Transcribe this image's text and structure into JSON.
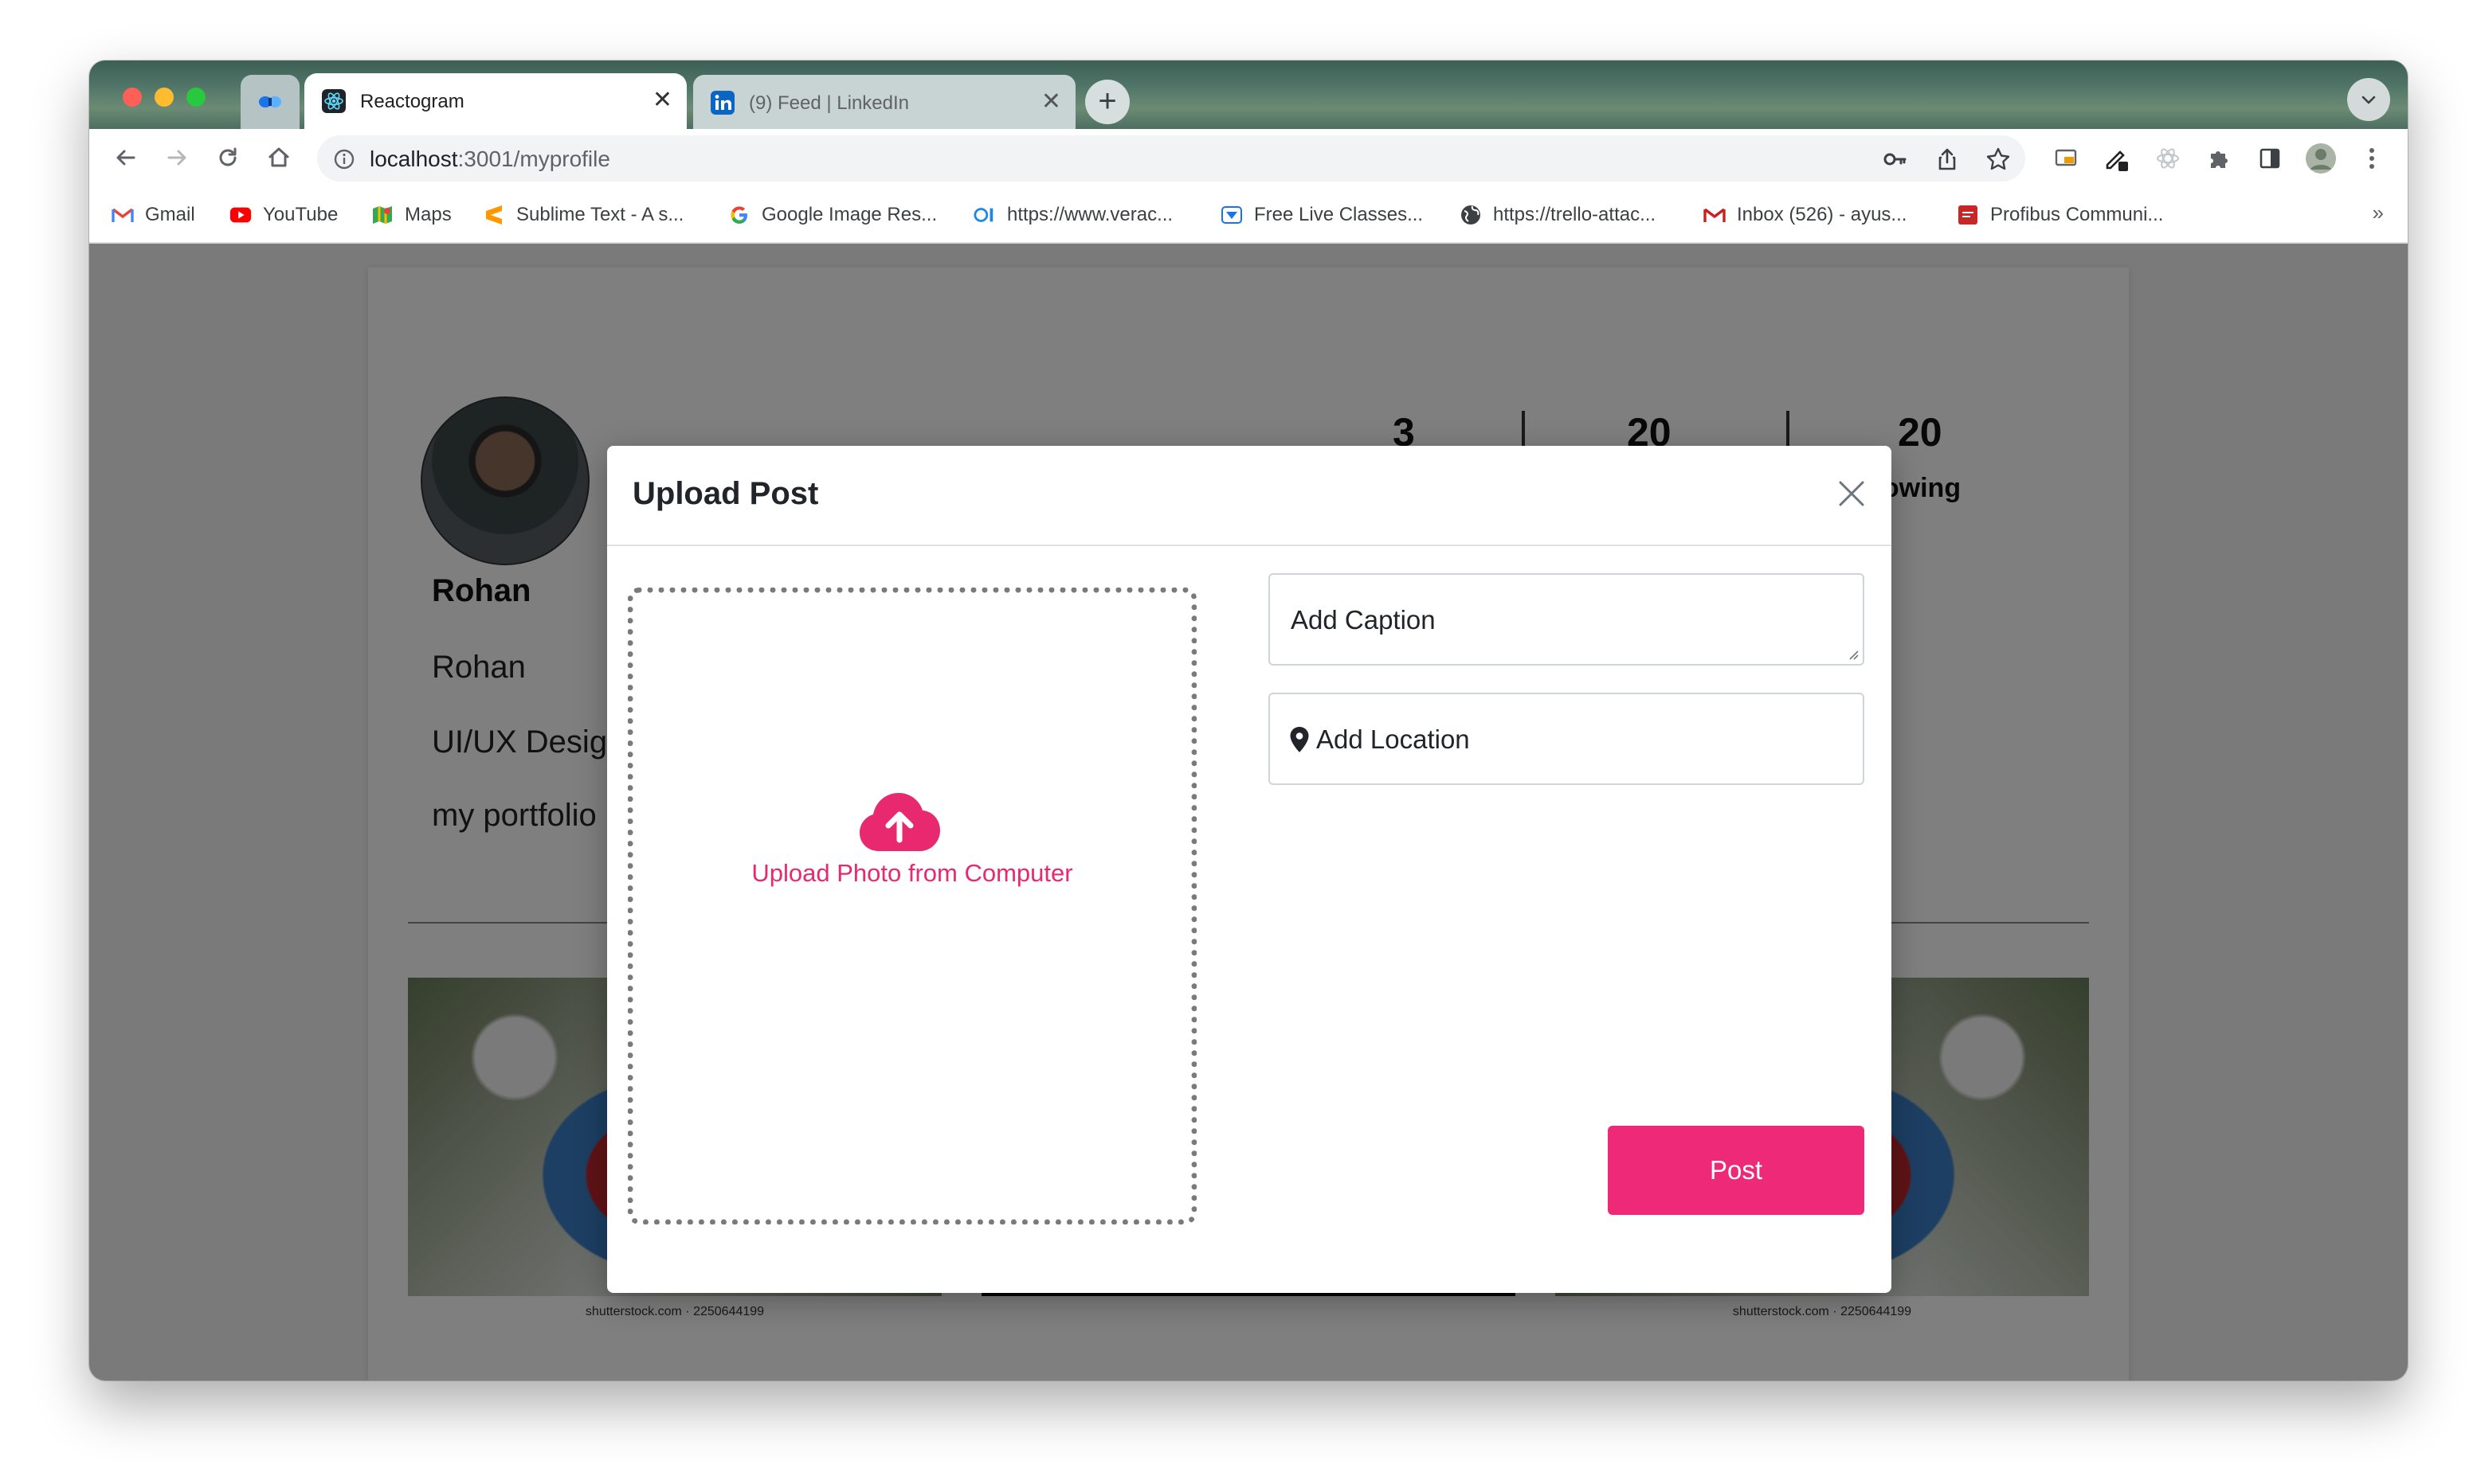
{
  "browser": {
    "tabs": [
      {
        "label": "Reactogram",
        "active": true
      },
      {
        "label": "(9) Feed | LinkedIn",
        "active": false
      }
    ],
    "close_glyph": "✕",
    "newtab_glyph": "+",
    "url_host": "localhost",
    "url_path": ":3001/myprofile"
  },
  "bookmarks": [
    {
      "label": "Gmail",
      "icon": "gmail-icon"
    },
    {
      "label": "YouTube",
      "icon": "youtube-icon"
    },
    {
      "label": "Maps",
      "icon": "maps-icon"
    },
    {
      "label": "Sublime Text - A s...",
      "icon": "sublime-icon"
    },
    {
      "label": "Google Image Res...",
      "icon": "google-icon"
    },
    {
      "label": "https://www.verac...",
      "icon": "veracode-icon"
    },
    {
      "label": "Free Live Classes...",
      "icon": "classes-icon"
    },
    {
      "label": "https://trello-attac...",
      "icon": "globe-icon"
    },
    {
      "label": "Inbox (526) - ayus...",
      "icon": "gmail-icon"
    },
    {
      "label": "Profibus Communi...",
      "icon": "profibus-icon"
    }
  ],
  "bookmarks_more": "»",
  "profile": {
    "name": "Rohan",
    "fullname": "Rohan",
    "title": "UI/UX Desig",
    "portfolio": "my portfolio",
    "stats": [
      {
        "value": "3"
      },
      {
        "value": "20"
      },
      {
        "value": "20",
        "label": "llowing"
      }
    ]
  },
  "posts": [
    {
      "caption": "shutterstock.com · 2250644199"
    },
    {
      "caption": ""
    },
    {
      "caption": "shutterstock.com · 2250644199"
    }
  ],
  "modal": {
    "title": "Upload Post",
    "upload_label": "Upload Photo from Computer",
    "caption_placeholder": "Add Caption",
    "location_placeholder": "Add Location",
    "post_button": "Post"
  },
  "colors": {
    "accent": "#ee2a78",
    "upload_text": "#e8286f"
  }
}
